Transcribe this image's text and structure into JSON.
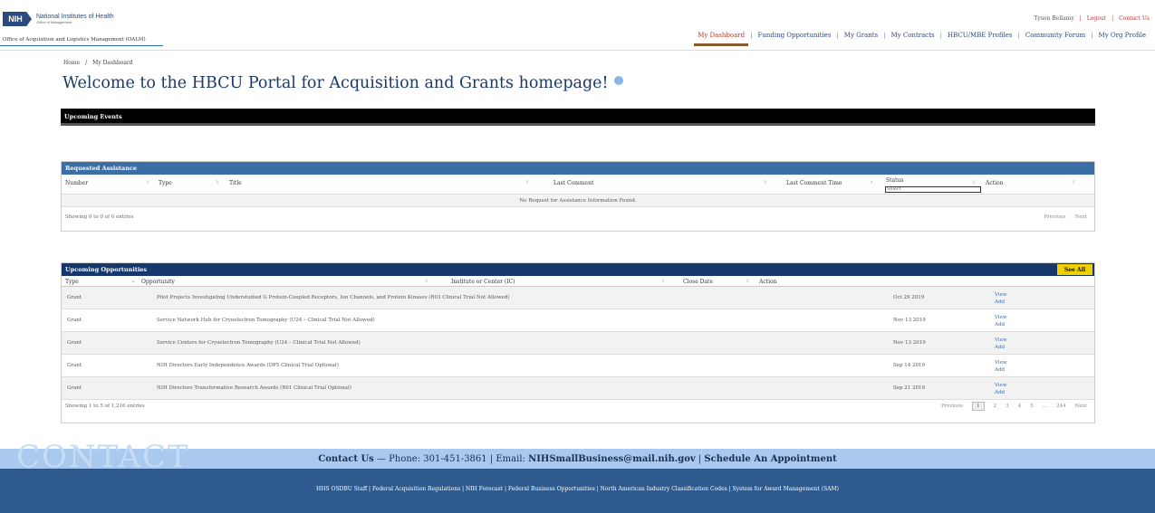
{
  "header": {
    "logo_badge": "NIH",
    "logo_title": "National Institutes of Health",
    "logo_subtitle": "Office of Management",
    "office_name": "Office of Acquisition and Logistics Management (OALM)",
    "user_name": "Tyson Bellamy",
    "logout_label": "Logout",
    "contact_label": "Contact Us",
    "nav": [
      {
        "label": "My Dashboard",
        "active": true
      },
      {
        "label": "Funding Opportunities"
      },
      {
        "label": "My Grants"
      },
      {
        "label": "My Contracts"
      },
      {
        "label": "HBCU/MBE Profiles"
      },
      {
        "label": "Community Forum"
      },
      {
        "label": "My Org Profile"
      }
    ]
  },
  "breadcrumb": {
    "home": "Home",
    "separator": "/",
    "current": "My Dashboard"
  },
  "page_title": "Welcome to the HBCU Portal for Acquisition and Grants homepage!",
  "events": {
    "title": "Upcoming Events"
  },
  "requested_assistance": {
    "title": "Requested Assistance",
    "columns": {
      "number": "Number",
      "type": "Type",
      "title": "Title",
      "last_comment": "Last Comment",
      "last_comment_time": "Last Comment Time",
      "status": "Status",
      "action": "Action"
    },
    "status_select": "Select",
    "empty_message": "No Request for Assistance Information Found.",
    "showing": "Showing 0 to 0 of 0 entries",
    "previous": "Previous",
    "next": "Next"
  },
  "upcoming_opportunities": {
    "title": "Upcoming Opportunities",
    "see_all": "See All",
    "columns": {
      "type": "Type",
      "opportunity": "Opportunity",
      "institute": "Institute or Center (IC)",
      "close_date": "Close Date",
      "action": "Action"
    },
    "rows": [
      {
        "type": "Grant",
        "opportunity": "Pilot Projects Investigating Understudied G Protein-Coupled Receptors, Ion Channels, and Protein Kinases (R03 Clinical Trial Not Allowed)",
        "close_date": "Oct 29 2019",
        "view": "View",
        "add": "Add"
      },
      {
        "type": "Grant",
        "opportunity": "Service Network Hub for Cryoelectron Tomography (U24 – Clinical Trial Not Allowed)",
        "close_date": "Nov 13 2019",
        "view": "View",
        "add": "Add"
      },
      {
        "type": "Grant",
        "opportunity": "Service Centers for Cryoelectron Tomography (U24 – Clinical Trial Not Allowed)",
        "close_date": "Nov 13 2019",
        "view": "View",
        "add": "Add"
      },
      {
        "type": "Grant",
        "opportunity": "NIH Directors Early Independence Awards (DP5 Clinical Trial Optional)",
        "close_date": "Sep 14 2019",
        "view": "View",
        "add": "Add"
      },
      {
        "type": "Grant",
        "opportunity": "NIH Directors Transformative Research Awards (R01 Clinical Trial Optional)",
        "close_date": "Sep 21 2019",
        "view": "View",
        "add": "Add"
      }
    ],
    "showing": "Showing 1 to 5 of 1,216 entries",
    "pagination": {
      "previous": "Previous",
      "pages": [
        "1",
        "2",
        "3",
        "4",
        "5",
        "…",
        "244"
      ],
      "next": "Next"
    }
  },
  "footer": {
    "watermark": "CONTACT",
    "contact_label": "Contact Us",
    "phone_text": " — Phone: 301-451-3861 | Email: ",
    "email": "NIHSmallBusiness@mail.nih.gov",
    "divider": " | ",
    "schedule": "Schedule An Appointment",
    "links": "HHS OSDBU Staff | Federal Acquisition Regulations | NIH Forecast | Federal Business Opportunities | North American Industry Classification Codes | System for Award Management (SAM)"
  },
  "colors": {
    "brand_blue": "#2a4a80",
    "panel_blue": "#3b6ea5",
    "panel_navy": "#15376b",
    "accent_red": "#c0392b",
    "see_all_yellow": "#f0d000",
    "footer_blue": "#2e5a8e",
    "contact_band": "#a9c9ee"
  }
}
